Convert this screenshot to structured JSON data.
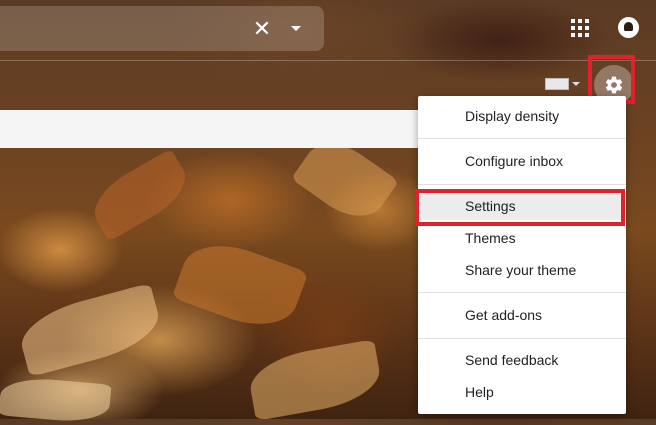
{
  "search": {
    "clear_glyph": "✕",
    "clear_icon": "close-icon",
    "options_icon": "triangle-down-icon"
  },
  "header": {
    "apps_icon": "apps-grid-icon",
    "notifications_icon": "notifications-icon"
  },
  "toolbar": {
    "keyboard_icon": "keyboard-icon",
    "settings_icon": "gear-icon"
  },
  "menu": {
    "display_density": "Display density",
    "configure_inbox": "Configure inbox",
    "settings": "Settings",
    "themes": "Themes",
    "share_theme": "Share your theme",
    "get_addons": "Get add-ons",
    "send_feedback": "Send feedback",
    "help": "Help"
  },
  "colors": {
    "highlight": "#e0222c",
    "menu_bg": "#ffffff",
    "active_item_bg": "#ececec"
  }
}
